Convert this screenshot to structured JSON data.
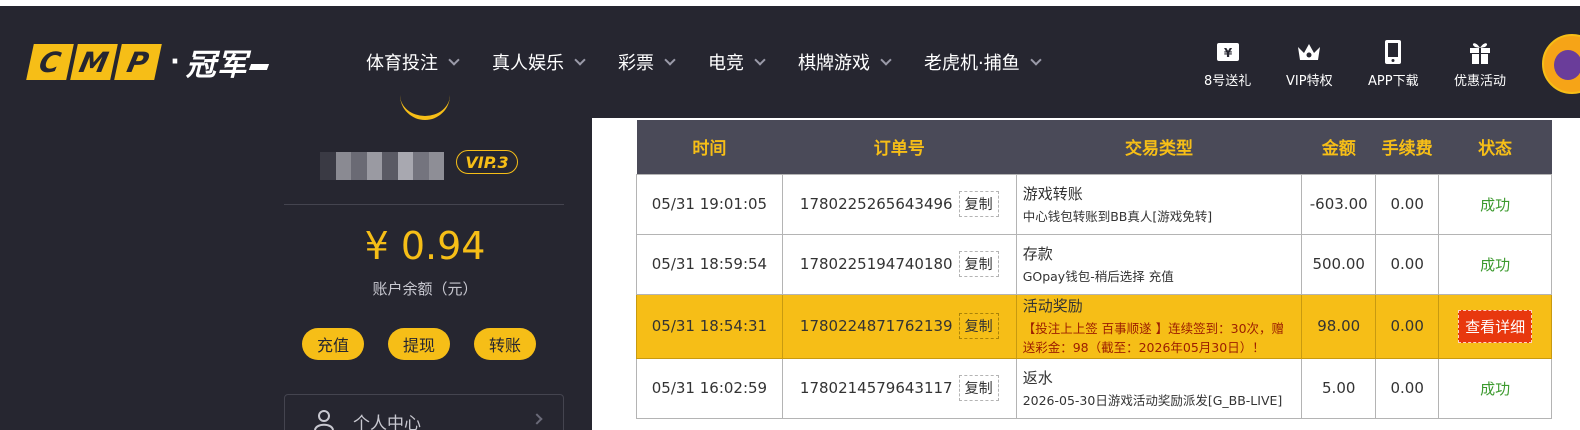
{
  "header": {
    "logo": {
      "letters": [
        "C",
        "M",
        "P"
      ],
      "separator": "·",
      "brand_cn": "冠军"
    },
    "nav": [
      {
        "label": "体育投注"
      },
      {
        "label": "真人娱乐"
      },
      {
        "label": "彩票"
      },
      {
        "label": "电竞"
      },
      {
        "label": "棋牌游戏"
      },
      {
        "label": "老虎机·捕鱼"
      }
    ],
    "quick_links": [
      {
        "label": "8号送礼",
        "icon": "ticket-icon"
      },
      {
        "label": "VIP特权",
        "icon": "crown-icon"
      },
      {
        "label": "APP下载",
        "icon": "phone-icon"
      },
      {
        "label": "优惠活动",
        "icon": "gift-icon"
      }
    ]
  },
  "sidebar": {
    "vip_badge": "VIP.3",
    "balance": "¥ 0.94",
    "balance_label": "账户余额（元）",
    "actions": [
      "充值",
      "提现",
      "转账"
    ],
    "menu_item": "个人中心"
  },
  "table": {
    "headers": [
      "时间",
      "订单号",
      "交易类型",
      "金额",
      "手续费",
      "状态"
    ],
    "copy_label": "复制",
    "rows": [
      {
        "time": "05/31 19:01:05",
        "order": "1780225265643496",
        "type": "游戏转账",
        "type_detail": "中心钱包转账到BB真人[游戏免转]",
        "amount": "-603.00",
        "fee": "0.00",
        "status": "成功"
      },
      {
        "time": "05/31 18:59:54",
        "order": "1780225194740180",
        "type": "存款",
        "type_detail": "GOpay钱包-稍后选择 充值",
        "amount": "500.00",
        "fee": "0.00",
        "status": "成功"
      },
      {
        "time": "05/31 18:54:31",
        "order": "1780224871762139",
        "type": "活动奖励",
        "type_detail": "【投注上上签 百事顺遂 】连续签到：30次，赠送彩金：98（截至：2026年05月30日）！",
        "amount": "98.00",
        "fee": "0.00",
        "status": "查看详细"
      },
      {
        "time": "05/31 16:02:59",
        "order": "1780214579643117",
        "type": "返水",
        "type_detail": "2026-05-30日游戏活动奖励派发[G_BB-LIVE]",
        "amount": "5.00",
        "fee": "0.00",
        "status": "成功"
      }
    ]
  },
  "colors": {
    "header_bg": "#262630",
    "accent": "#f6be17",
    "table_header_bg": "#4a4a58",
    "success": "#3c9a2e",
    "detail_button": "#e8380e"
  }
}
